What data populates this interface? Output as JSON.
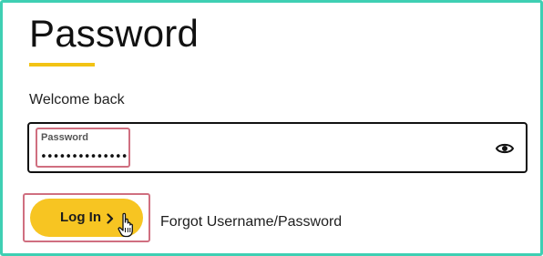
{
  "header": {
    "title": "Password",
    "subtitle": "Welcome back"
  },
  "password_field": {
    "label": "Password",
    "value": "••••••••••••••",
    "toggle_icon": "eye-icon"
  },
  "actions": {
    "login_label": "Log In",
    "login_icon": "chevron-right-icon",
    "forgot_label": "Forgot Username/Password"
  },
  "colors": {
    "accent_yellow": "#f7c522",
    "underline_yellow": "#f2c314",
    "frame_teal": "#3fcfb3",
    "highlight_pink": "#d06f80"
  }
}
